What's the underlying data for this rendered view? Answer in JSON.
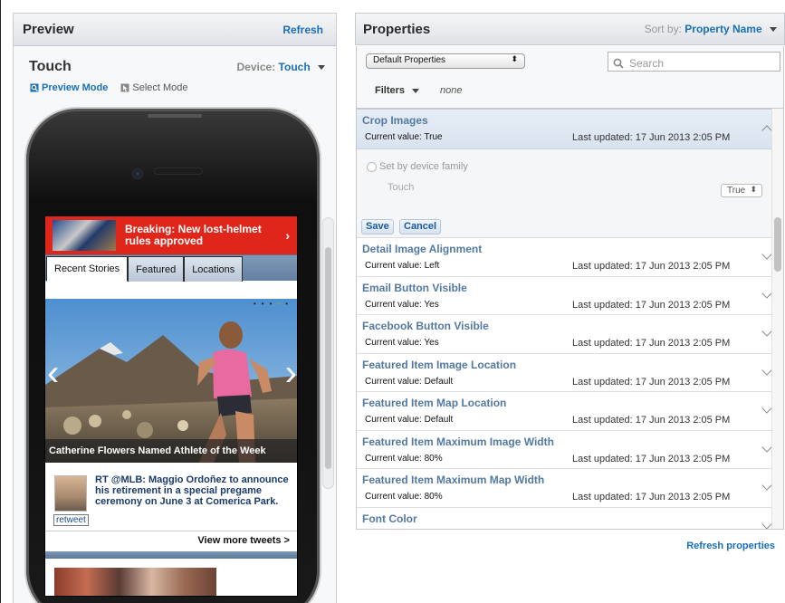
{
  "preview": {
    "title": "Preview",
    "refresh": "Refresh",
    "subtitle": "Touch",
    "device_label": "Device:",
    "device_value": "Touch",
    "modes": {
      "preview": "Preview Mode",
      "select": "Select Mode"
    },
    "phone": {
      "breaking": "Breaking: New lost-helmet rules approved",
      "tabs": [
        "Recent Stories",
        "Featured",
        "Locations"
      ],
      "hero_caption": "Catherine Flowers Named Athlete of the Week",
      "tweet": "RT @MLB: Maggio Ordoñez to announce his retirement in a special pregame ceremony on June 3 at Comerica Park.",
      "retweet": "retweet",
      "view_more": "View more tweets >"
    }
  },
  "properties": {
    "title": "Properties",
    "sort_label": "Sort by:",
    "sort_value": "Property Name",
    "select_value": "Default Properties",
    "search_placeholder": "Search",
    "filters_label": "Filters",
    "filters_value": "none",
    "current_prefix": "Current value:",
    "updated_prefix": "Last updated:",
    "selected": {
      "name": "Crop Images",
      "current": "Current value: True",
      "updated": "Last updated: 17 Jun 2013 2:05 PM",
      "set_by": "Set by device family",
      "family": "Touch",
      "value": "True",
      "save": "Save",
      "cancel": "Cancel"
    },
    "items": [
      {
        "name": "Detail Image Alignment",
        "current": "Current value: Left",
        "updated": "Last updated: 17 Jun 2013 2:05 PM"
      },
      {
        "name": "Email Button Visible",
        "current": "Current value: Yes",
        "updated": "Last updated: 17 Jun 2013 2:05 PM"
      },
      {
        "name": "Facebook Button Visible",
        "current": "Current value: Yes",
        "updated": "Last updated: 17 Jun 2013 2:05 PM"
      },
      {
        "name": "Featured Item Image Location",
        "current": "Current value: Default",
        "updated": "Last updated: 17 Jun 2013 2:05 PM"
      },
      {
        "name": "Featured Item Map Location",
        "current": "Current value: Default",
        "updated": "Last updated: 17 Jun 2013 2:05 PM"
      },
      {
        "name": "Featured Item Maximum Image Width",
        "current": "Current value: 80%",
        "updated": "Last updated: 17 Jun 2013 2:05 PM"
      },
      {
        "name": "Featured Item Maximum Map Width",
        "current": "Current value: 80%",
        "updated": "Last updated: 17 Jun 2013 2:05 PM"
      },
      {
        "name": "Font Color",
        "current": "",
        "updated": ""
      }
    ],
    "refresh_properties": "Refresh properties"
  }
}
